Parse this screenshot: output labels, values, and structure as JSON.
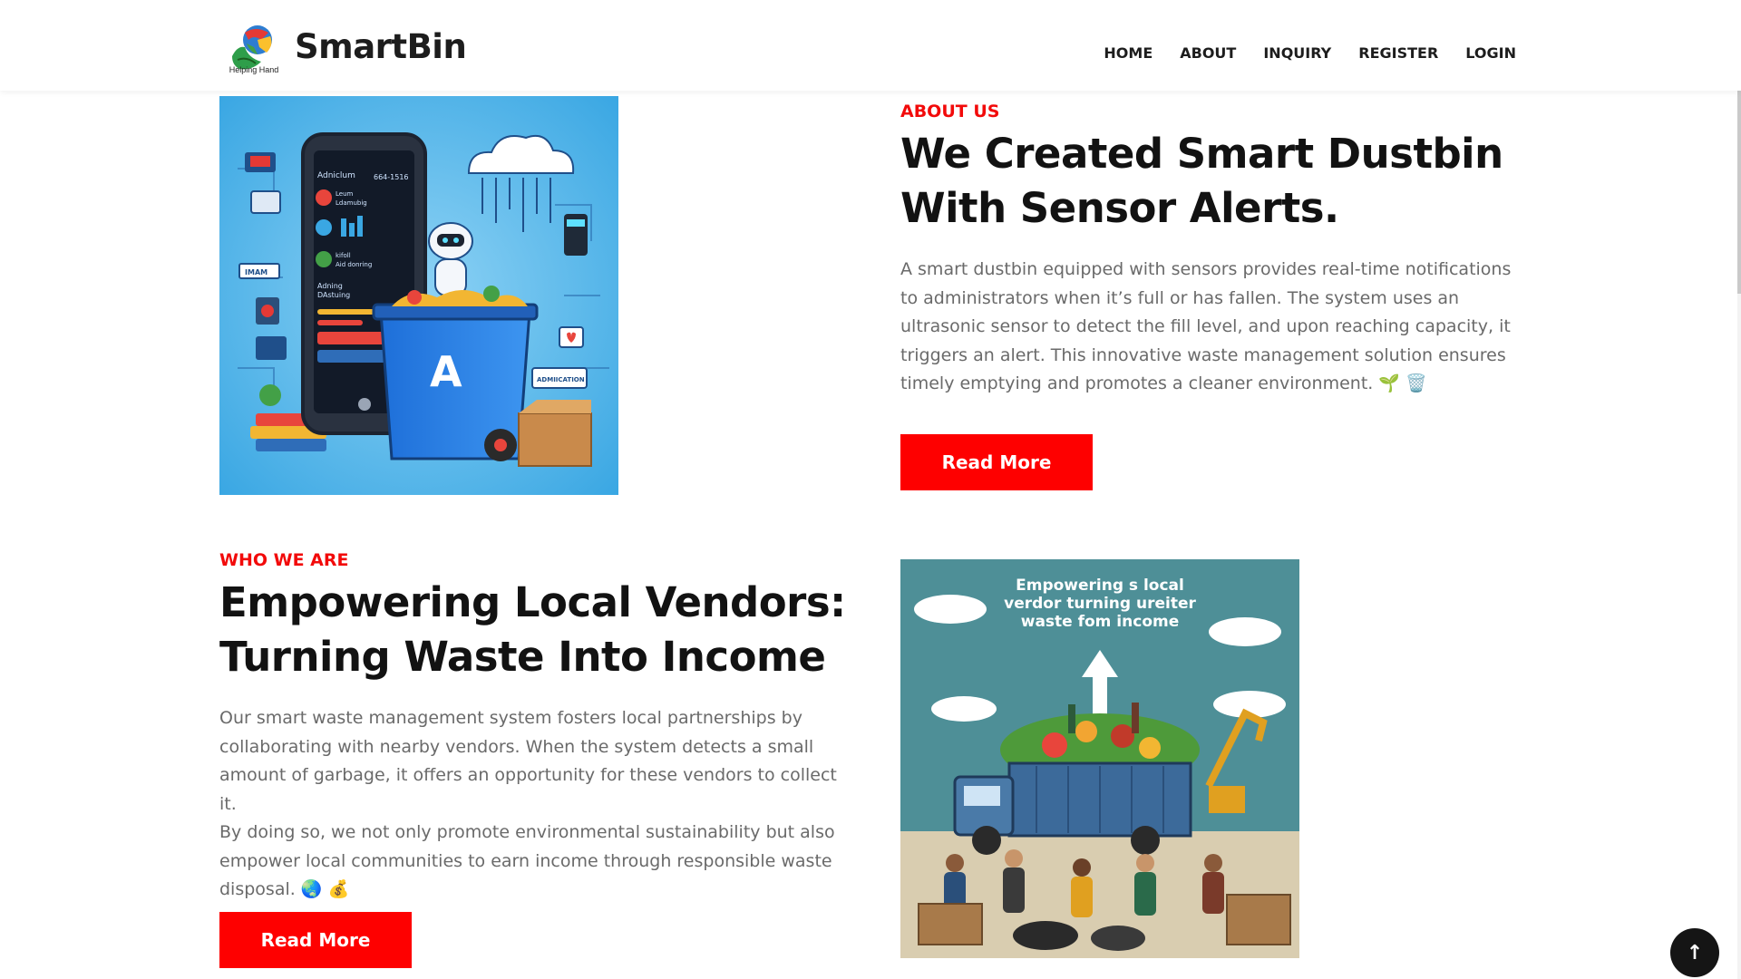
{
  "header": {
    "logo_caption": "Helping Hand",
    "brand": "SmartBin",
    "nav": [
      "HOME",
      "ABOUT",
      "INQUIRY",
      "REGISTER",
      "LOGIN"
    ]
  },
  "about": {
    "eyebrow": "ABOUT US",
    "headline_line1": "We Created Smart Dustbin",
    "headline_line2": "With Sensor Alerts.",
    "lines": [
      "A smart dustbin equipped with sensors provides real-time notifications",
      "to administrators when it’s full or has fallen. The system uses an",
      "ultrasonic sensor to detect the fill level, and upon reaching capacity, it",
      "triggers an alert. This innovative waste management solution ensures",
      "timely emptying and promotes a cleaner environment. 🌱 🗑️"
    ],
    "button": "Read More",
    "image_text": {
      "a": "Adniclum",
      "b": "664-1516",
      "c": "Leum",
      "d": "Ldamubig",
      "e": "kifoll",
      "f": "Aid donring",
      "g": "Adning",
      "h": "DAstuing",
      "i": "IMAM",
      "j": "ADMIICATION",
      "bin_letter": "A"
    }
  },
  "who": {
    "eyebrow": "WHO WE ARE",
    "headline_line1": "Empowering Local Vendors:",
    "headline_line2": "Turning Waste Into Income",
    "lines": [
      "Our smart waste management system fosters local partnerships by",
      "collaborating with nearby vendors. When the system detects a small",
      "amount of garbage, it offers an opportunity for these vendors to collect it.",
      "By doing so, we not only promote environmental sustainability but also",
      "empower local communities to earn income through responsible waste",
      "disposal. 🌏 💰"
    ],
    "button": "Read More",
    "image_text": [
      "Empowering s local",
      "verdor turning ureiter",
      "waste fom income"
    ]
  },
  "back_to_top": "↑"
}
